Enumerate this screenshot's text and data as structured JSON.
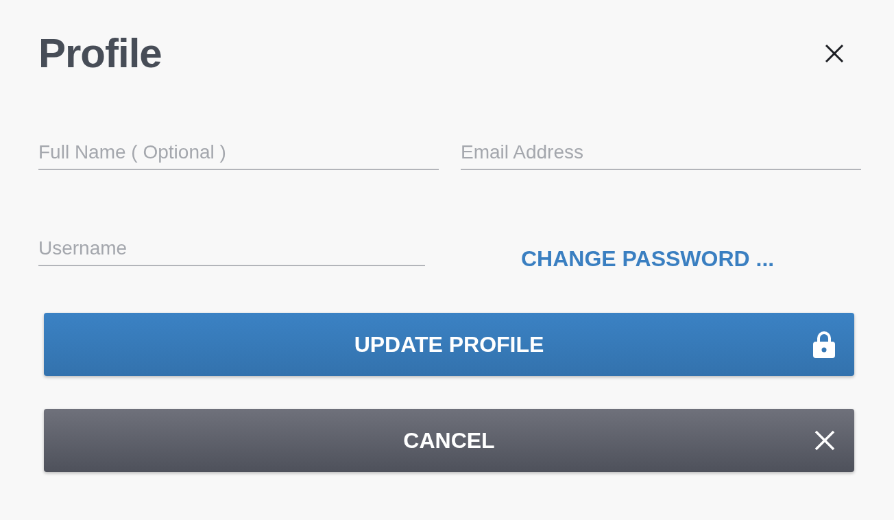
{
  "title": "Profile",
  "fields": [
    {
      "placeholder": "Full Name ( Optional )"
    },
    {
      "placeholder": "Email Address"
    },
    {
      "placeholder": "Username"
    }
  ],
  "change_password_link": "CHANGE PASSWORD ...",
  "buttons": [
    {
      "label": "UPDATE PROFILE",
      "kind": "primary"
    },
    {
      "label": "CANCEL",
      "kind": "secondary"
    }
  ]
}
